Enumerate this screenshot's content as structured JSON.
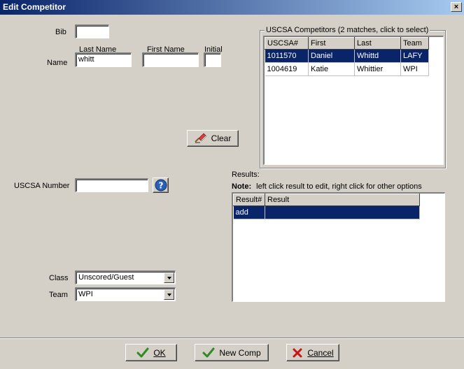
{
  "window": {
    "title": "Edit Competitor",
    "close_label": "×"
  },
  "form": {
    "bib_label": "Bib",
    "bib_value": "",
    "name_label": "Name",
    "last_name_label": "Last Name",
    "first_name_label": "First Name",
    "initial_label": "Initial",
    "last_name_value": "whitt",
    "first_name_value": "",
    "initial_value": "",
    "clear_label": "Clear",
    "uscsa_number_label": "USCSA Number",
    "uscsa_number_value": "",
    "help_label": "?",
    "class_label": "Class",
    "class_value": "Unscored/Guest",
    "team_label": "Team",
    "team_value": "WPI"
  },
  "competitors": {
    "legend": "USCSA Competitors (2 matches, click to select)",
    "columns": [
      "USCSA#",
      "First",
      "Last",
      "Team"
    ],
    "rows": [
      [
        "1011570",
        "Daniel",
        "Whittd",
        "LAFY"
      ],
      [
        "1004619",
        "Katie",
        "Whittier",
        "WPI"
      ]
    ],
    "selected_row": 0
  },
  "results": {
    "label": "Results:",
    "note_bold": "Note:",
    "note_text": "left click result to edit, right click for other options",
    "columns": [
      "Result#",
      "Result"
    ],
    "rows": [
      [
        "add",
        ""
      ]
    ]
  },
  "footer": {
    "ok_label": "OK",
    "new_comp_label": "New Comp",
    "cancel_label": "Cancel"
  },
  "colors": {
    "selection": "#0a246a",
    "ok_check": "#2e8b22",
    "cancel_x": "#c81414",
    "help_blue": "#2a5fb8"
  }
}
